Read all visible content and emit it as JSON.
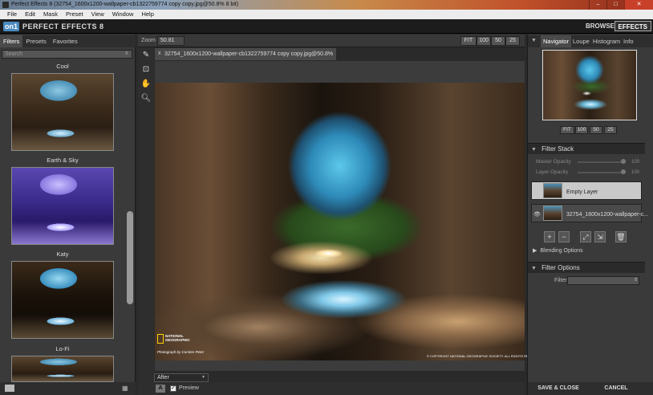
{
  "window": {
    "title": "Perfect Effects 8 (32754_1600x1200-wallpaper-cb1322759774 copy copy.jpg@50.8% 8 bit)"
  },
  "menu": [
    "File",
    "Edit",
    "Mask",
    "Preset",
    "View",
    "Window",
    "Help"
  ],
  "brand": {
    "logo_mark": "on1",
    "logo_text": "PERFECT EFFECTS 8",
    "browse": "BROWSE",
    "effects": "EFFECTS"
  },
  "left_panel": {
    "tabs": [
      "Filters",
      "Presets",
      "Favorites"
    ],
    "search_placeholder": "Search",
    "search_clear": "x",
    "presets": [
      {
        "header": "Cool"
      },
      {
        "label": "Earth & Sky"
      },
      {
        "label": "Katy"
      },
      {
        "label": "Lo-Fi"
      }
    ]
  },
  "toolbar": {
    "zoom_label": "Zoom",
    "zoom_value": "50.81",
    "zoom_buttons": [
      "FIT",
      "100",
      "50",
      "25"
    ]
  },
  "document": {
    "tab_title": "32754_1600x1200-wallpaper-cb1322759774 copy copy.jpg@50.8% 8 bit",
    "close": "x",
    "ng_text": "NATIONAL GEOGRAPHIC",
    "photo_credit": "Photograph by Carsten Peter",
    "copyright": "© COPYRIGHT NATIONAL GEOGRAPHIC SOCIETY. ALL RIGHTS RESERVED."
  },
  "view": {
    "mode": "After",
    "a_button": "A",
    "preview_checked": "✓",
    "preview_label": "Preview"
  },
  "right_panel": {
    "tabs": [
      "Navigator",
      "Loupe",
      "Histogram",
      "Info"
    ],
    "nav_buttons": [
      "FIT",
      "100",
      "50",
      "25"
    ],
    "filter_stack": {
      "title": "Filter Stack",
      "master_opacity": "Master Opacity",
      "master_value": "100",
      "layer_opacity": "Layer Opacity",
      "layer_value": "100",
      "layers": [
        "Empty Layer",
        "32754_1600x1200-wallpaper-c..."
      ],
      "blending": "Blending Options"
    },
    "filter_options": {
      "title": "Filter Options",
      "filter_label": "Filter"
    },
    "save_close": "SAVE & CLOSE",
    "cancel": "CANCEL"
  }
}
